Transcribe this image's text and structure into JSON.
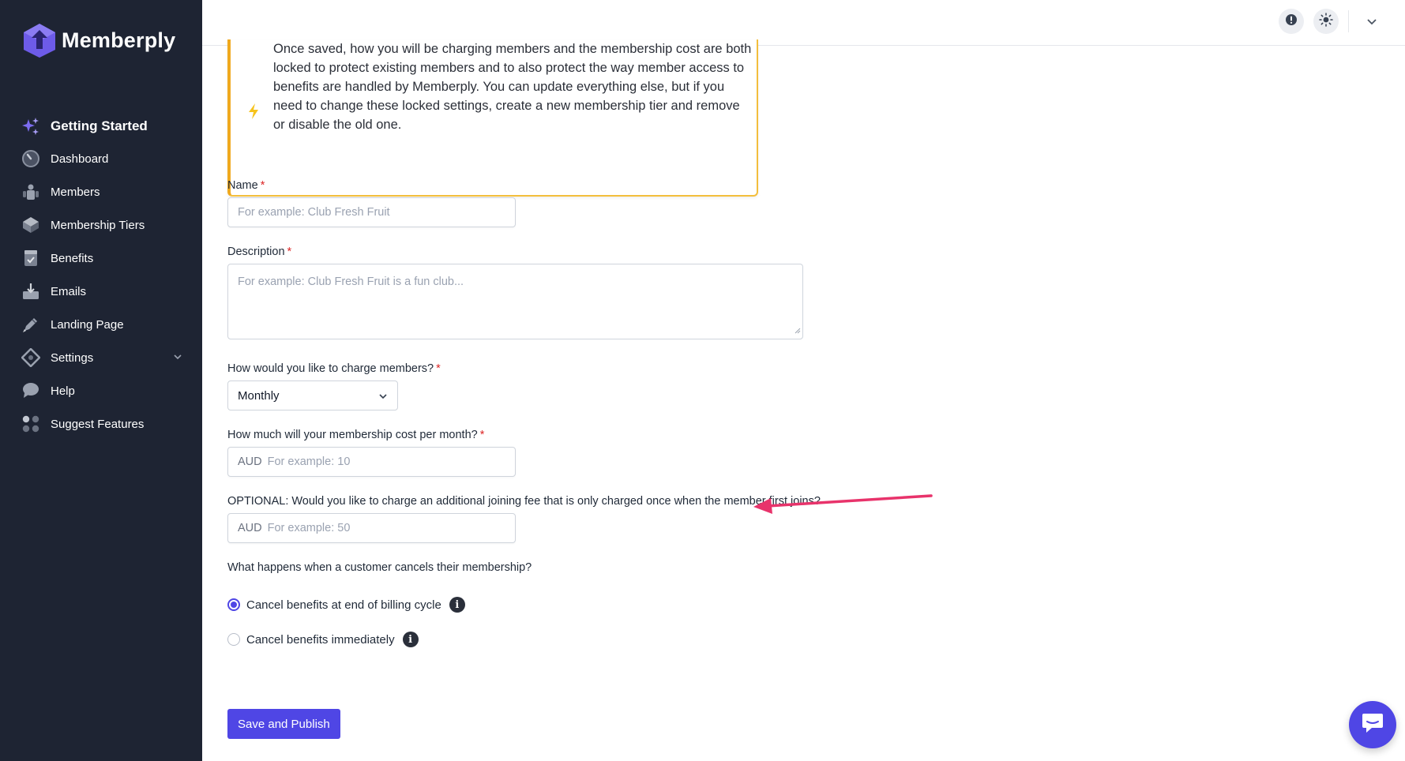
{
  "brand": {
    "name": "Memberply",
    "accent": "#4f46e5"
  },
  "sidebar": {
    "items": [
      {
        "label": "Getting Started",
        "icon": "sparkles-icon"
      },
      {
        "label": "Dashboard",
        "icon": "gauge-icon"
      },
      {
        "label": "Members",
        "icon": "users-icon"
      },
      {
        "label": "Membership Tiers",
        "icon": "layers-icon"
      },
      {
        "label": "Benefits",
        "icon": "clipboard-check-icon"
      },
      {
        "label": "Emails",
        "icon": "inbox-icon"
      },
      {
        "label": "Landing Page",
        "icon": "pencil-icon"
      },
      {
        "label": "Settings",
        "icon": "settings-icon"
      },
      {
        "label": "Help",
        "icon": "chat-bubble-icon"
      },
      {
        "label": "Suggest Features",
        "icon": "grid-dots-icon"
      }
    ]
  },
  "notice": {
    "text": "Once saved, how you will be charging members and the membership cost are both locked to protect existing members and to also protect the way member access to benefits are handled by Memberply. You can update everything else, but if you need to change these locked settings, create a new membership tier and remove or disable the old one."
  },
  "form": {
    "name": {
      "label": "Name",
      "required": "*",
      "placeholder": "For example: Club Fresh Fruit"
    },
    "description": {
      "label": "Description",
      "required": "*",
      "placeholder": "For example: Club Fresh Fruit is a fun club..."
    },
    "charge": {
      "label": "How would you like to charge members?",
      "required": "*",
      "value": "Monthly"
    },
    "cost": {
      "label": "How much will your membership cost per month?",
      "required": "*",
      "prefix": "AUD",
      "placeholder": "For example: 10"
    },
    "joining_fee": {
      "label": "OPTIONAL: Would you like to charge an additional joining fee that is only charged once when the member first joins?",
      "prefix": "AUD",
      "placeholder": "For example: 50"
    },
    "cancel": {
      "label": "What happens when a customer cancels their membership?",
      "options": [
        {
          "label": "Cancel benefits at end of billing cycle",
          "checked": true
        },
        {
          "label": "Cancel benefits immediately",
          "checked": false
        }
      ]
    },
    "save_label": "Save and Publish"
  },
  "colors": {
    "sidebar_bg": "#1e2433",
    "notice_border": "#f0a91e",
    "arrow": "#e8336b",
    "primary": "#4f46e5"
  }
}
